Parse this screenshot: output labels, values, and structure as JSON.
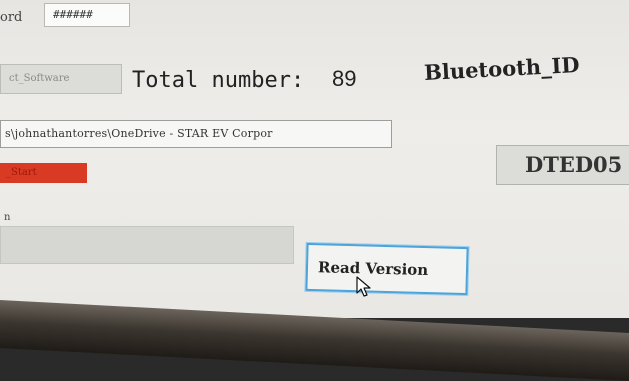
{
  "password": {
    "label": "ord",
    "value": "######"
  },
  "select_software": {
    "label": "ct_Software"
  },
  "total": {
    "label": "Total number:",
    "value": "89"
  },
  "bluetooth": {
    "label": "Bluetooth_ID",
    "value": "DTED05"
  },
  "path": {
    "value": "s\\johnathantorres\\OneDrive - STAR EV Corpor"
  },
  "start": {
    "label": "_Start",
    "color": "#d83a24"
  },
  "version": {
    "label": "n",
    "value": ""
  },
  "read_version": {
    "label": "Read Version",
    "accent": "#4ea3d9"
  },
  "icons": {
    "cursor": "mouse-pointer-icon"
  }
}
